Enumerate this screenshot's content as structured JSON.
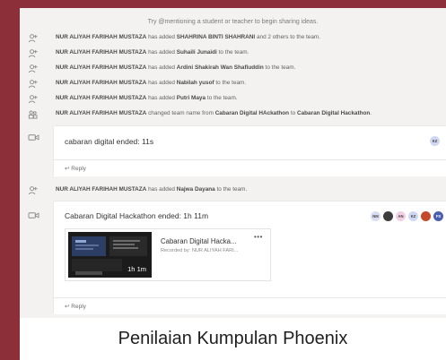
{
  "hint_text": "Try @mentioning a student or teacher to begin sharing ideas.",
  "events": [
    {
      "actor": "NUR ALIYAH FARIHAH MUSTAZA",
      "pre": " has added ",
      "target": "SHAHRINA BINTI SHAHRANI",
      "post": " and 2 others to the team.",
      "icon": "add-user-icon"
    },
    {
      "actor": "NUR ALIYAH FARIHAH MUSTAZA",
      "pre": " has added ",
      "target": "Suhaili Junaidi",
      "post": " to the team.",
      "icon": "add-user-icon"
    },
    {
      "actor": "NUR ALIYAH FARIHAH MUSTAZA",
      "pre": " has added ",
      "target": "Ardini Shakirah Wan Shafiuddin",
      "post": " to the team.",
      "icon": "add-user-icon"
    },
    {
      "actor": "NUR ALIYAH FARIHAH MUSTAZA",
      "pre": " has added ",
      "target": "Nabilah yusof",
      "post": " to the team.",
      "icon": "add-user-icon"
    },
    {
      "actor": "NUR ALIYAH FARIHAH MUSTAZA",
      "pre": " has added ",
      "target": "Putri Maya",
      "post": " to the team.",
      "icon": "add-user-icon"
    },
    {
      "actor": "NUR ALIYAH FARIHAH MUSTAZA",
      "pre": " changed team name from ",
      "target": "Cabaran Digital HAckathon",
      "mid": " to ",
      "target2": "Cabaran Digital Hackathon",
      "post": ".",
      "icon": "team-icon"
    }
  ],
  "meeting1": {
    "title": "cabaran digital ended: 11s",
    "reply_label": "Reply",
    "avatar": "KZ"
  },
  "event_after": {
    "actor": "NUR ALIYAH FARIHAH MUSTAZA",
    "pre": " has added ",
    "target": "Najwa Dayana",
    "post": " to the team.",
    "icon": "add-user-icon"
  },
  "meeting2": {
    "title": "Cabaran Digital Hackathon ended: 1h 11m",
    "reply_label": "Reply",
    "avatars": [
      "NM",
      "",
      "AN",
      "KZ",
      "",
      "FS"
    ],
    "recording": {
      "title": "Cabaran Digital Hacka...",
      "subtitle": "Recorded by: NUR ALIYAH FARI...",
      "duration": "1h 1m",
      "more": "•••"
    }
  },
  "caption": "Penilaian Kumpulan Phoenix",
  "colors": {
    "frame": "#8c2f38",
    "chat_bg": "#f3f2f1",
    "accent": "#6264a7"
  }
}
